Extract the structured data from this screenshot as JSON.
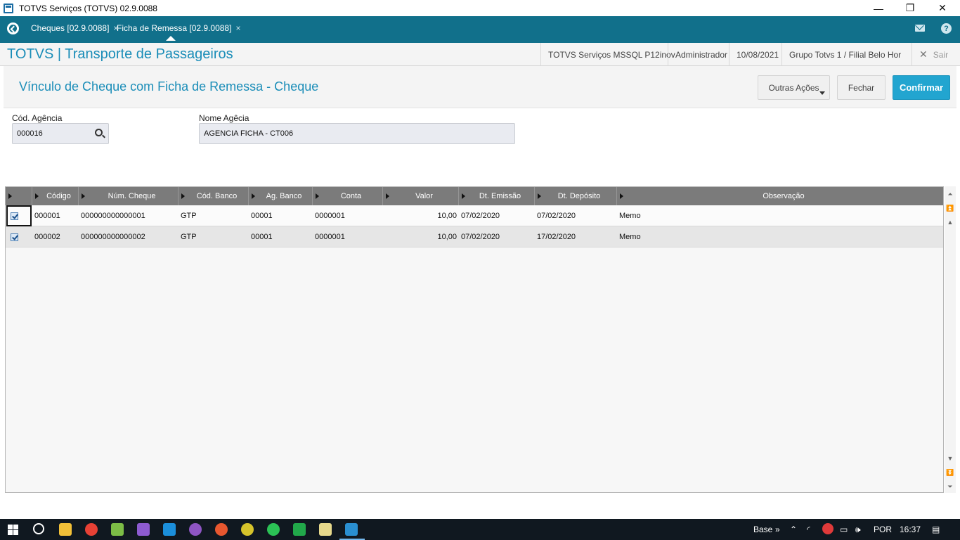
{
  "window": {
    "title": "TOTVS Serviços (TOTVS) 02.9.0088",
    "minimize": "—",
    "restore": "❐",
    "close": "✕"
  },
  "tabs": [
    {
      "label": "Cheques [02.9.0088]",
      "close": "×"
    },
    {
      "label": "Ficha de Remessa [02.9.0088]",
      "close": "×"
    }
  ],
  "header": {
    "app_title": "TOTVS | Transporte de Passageiros",
    "environment": "TOTVS Serviços MSSQL P12inov",
    "user": "Administrador",
    "date": "10/08/2021",
    "branch": "Grupo Totvs 1 / Filial Belo Hor",
    "exit_label": "Sair",
    "help_symbol": "?"
  },
  "page": {
    "title": "Vínculo de Cheque com Ficha de Remessa - Cheque",
    "buttons": {
      "more_actions": "Outras Ações",
      "close": "Fechar",
      "confirm": "Confirmar"
    }
  },
  "form": {
    "agency_code_label": "Cód. Agência",
    "agency_code_value": "000016",
    "agency_name_label": "Nome Agêcia",
    "agency_name_value": "AGENCIA FICHA - CT006"
  },
  "grid": {
    "columns": [
      "Código",
      "Núm. Cheque",
      "Cód. Banco",
      "Ag. Banco",
      "Conta",
      "Valor",
      "Dt. Emissão",
      "Dt. Depósito",
      "Observação"
    ],
    "rows": [
      {
        "checked": true,
        "codigo": "000001",
        "num_cheque": "000000000000001",
        "cod_banco": "GTP",
        "ag_banco": "00001",
        "conta": "0000001",
        "valor": "10,00",
        "dt_emissao": "07/02/2020",
        "dt_deposito": "07/02/2020",
        "observacao": "Memo"
      },
      {
        "checked": true,
        "codigo": "000002",
        "num_cheque": "000000000000002",
        "cod_banco": "GTP",
        "ag_banco": "00001",
        "conta": "0000001",
        "valor": "10,00",
        "dt_emissao": "07/02/2020",
        "dt_deposito": "17/02/2020",
        "observacao": "Memo"
      }
    ]
  },
  "taskbar": {
    "base_label": "Base",
    "language": "POR",
    "time": "16:37"
  }
}
